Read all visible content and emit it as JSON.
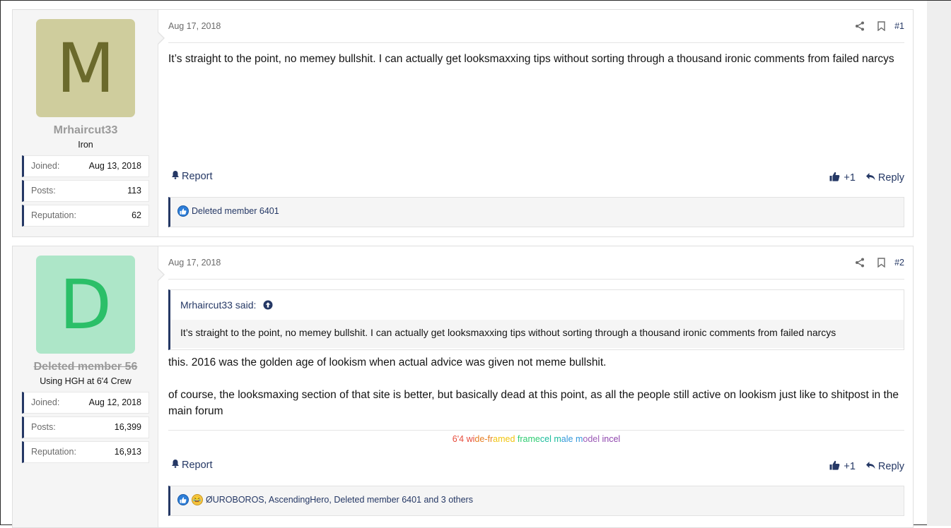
{
  "posts": [
    {
      "avatar_letter": "M",
      "avatar_bg": "#cfcd9d",
      "avatar_fg": "#6b6a2c",
      "username": "Mrhaircut33",
      "user_title": "Iron",
      "stats": [
        {
          "label": "Joined:",
          "value": "Aug 13, 2018"
        },
        {
          "label": "Posts:",
          "value": "113"
        },
        {
          "label": "Reputation:",
          "value": "62"
        }
      ],
      "date": "Aug 17, 2018",
      "number": "#1",
      "message": "It’s straight to the point, no memey bullshit. I can actually get looksmaxxing tips without sorting through a thousand ironic comments from failed narcys",
      "report_label": "Report",
      "like_label": "+1",
      "reply_label": "Reply",
      "reactions_text": "Deleted member 6401"
    },
    {
      "avatar_letter": "D",
      "avatar_bg": "#ade6c8",
      "avatar_fg": "#2bbf68",
      "username": "Deleted member 56",
      "user_title": "Using HGH at 6'4 Crew",
      "stats": [
        {
          "label": "Joined:",
          "value": "Aug 12, 2018"
        },
        {
          "label": "Posts:",
          "value": "16,399"
        },
        {
          "label": "Reputation:",
          "value": "16,913"
        }
      ],
      "date": "Aug 17, 2018",
      "number": "#2",
      "quote_author": "Mrhaircut33 said:",
      "quote_text": "It’s straight to the point, no memey bullshit. I can actually get looksmaxxing tips without sorting through a thousand ironic comments from failed narcys",
      "message_p1": "this. 2016 was the golden age of lookism when actual advice was given not meme bullshit.",
      "message_p2": "of course, the looksmaxing section of that site is better, but basically dead at this point, as all the people still active on lookism just like to shitpost in the main forum",
      "signature": "6'4 wide-framed framecel male model incel",
      "report_label": "Report",
      "like_label": "+1",
      "reply_label": "Reply",
      "reactions_text": "ØUROBOROS, AscendingHero, Deleted member 6401 and 3 others"
    }
  ],
  "colors": {
    "accent": "#253865",
    "link": "#253865",
    "muted": "#6b6b6b"
  }
}
